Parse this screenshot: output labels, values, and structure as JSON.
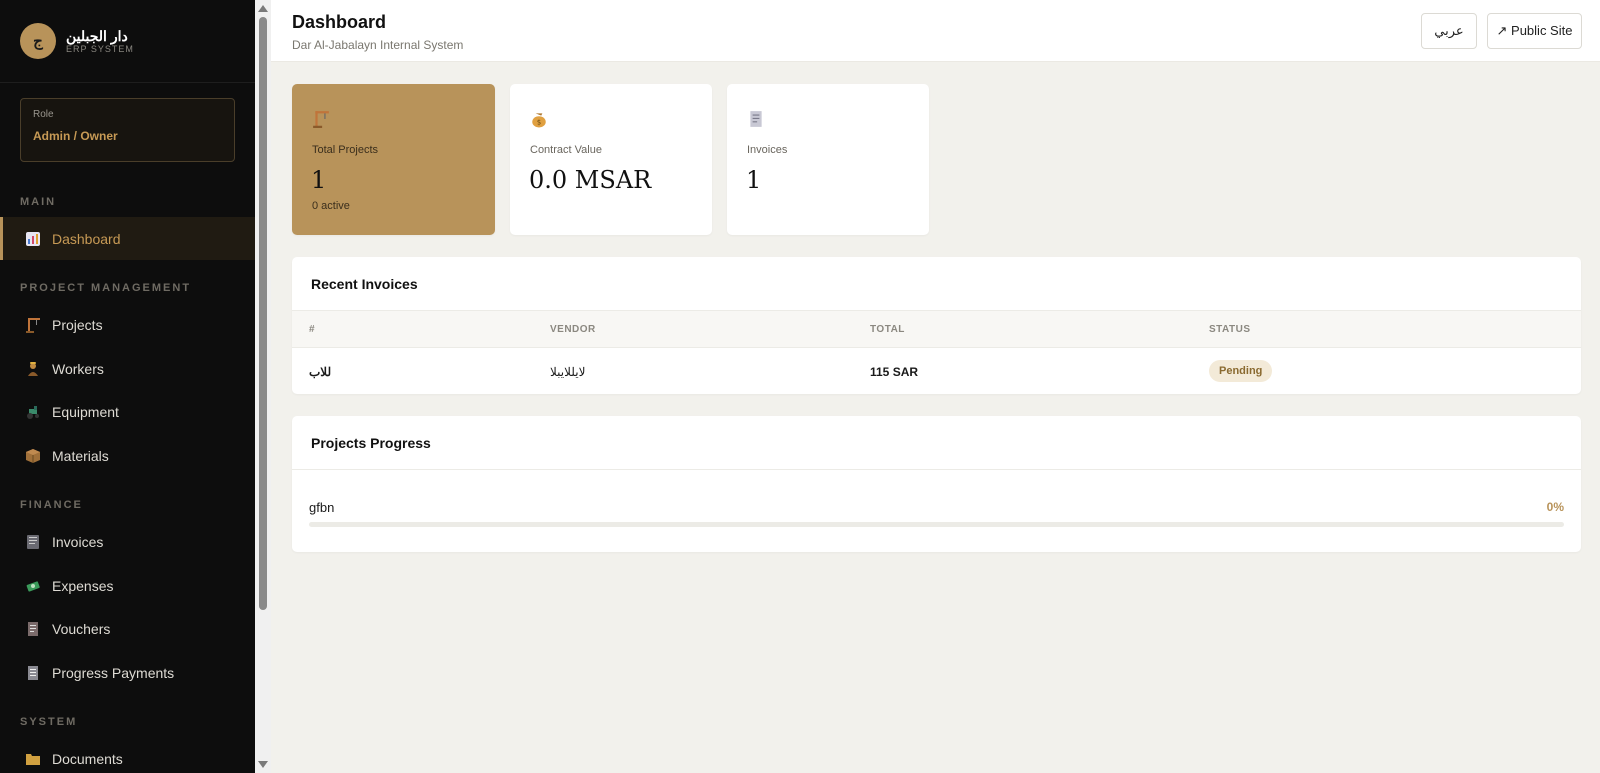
{
  "brand": {
    "logo_char": "ج",
    "name": "دار الجبلين",
    "subtitle": "ERP SYSTEM"
  },
  "role": {
    "label": "Role",
    "value": "Admin / Owner"
  },
  "sidebar": {
    "sections": {
      "main": "MAIN",
      "project_management": "PROJECT MANAGEMENT",
      "finance": "FINANCE",
      "system": "SYSTEM"
    },
    "items": {
      "dashboard": "Dashboard",
      "projects": "Projects",
      "workers": "Workers",
      "equipment": "Equipment",
      "materials": "Materials",
      "invoices": "Invoices",
      "expenses": "Expenses",
      "vouchers": "Vouchers",
      "progress_payments": "Progress Payments",
      "documents": "Documents"
    }
  },
  "header": {
    "title": "Dashboard",
    "subtitle": "Dar Al-Jabalayn Internal System",
    "lang_button": "عربي",
    "public_site_button": "↗ Public Site"
  },
  "stats": {
    "projects": {
      "label": "Total Projects",
      "value": "1",
      "extra": "0 active"
    },
    "contract": {
      "label": "Contract Value",
      "value": "0.0 MSAR"
    },
    "invoices": {
      "label": "Invoices",
      "value": "1"
    }
  },
  "recent_invoices": {
    "title": "Recent Invoices",
    "columns": [
      "#",
      "VENDOR",
      "TOTAL",
      "STATUS"
    ],
    "rows": [
      {
        "number": "للاب",
        "vendor": "لايللايبلا",
        "total": "115 SAR",
        "status": "Pending"
      }
    ]
  },
  "projects_progress": {
    "title": "Projects Progress",
    "items": [
      {
        "name": "gfbn",
        "percent_label": "0%",
        "percent": 0
      }
    ]
  },
  "colors": {
    "accent": "#b8935a",
    "sidebar_bg": "#0d0d0d",
    "page_bg": "#f2f1ec"
  }
}
